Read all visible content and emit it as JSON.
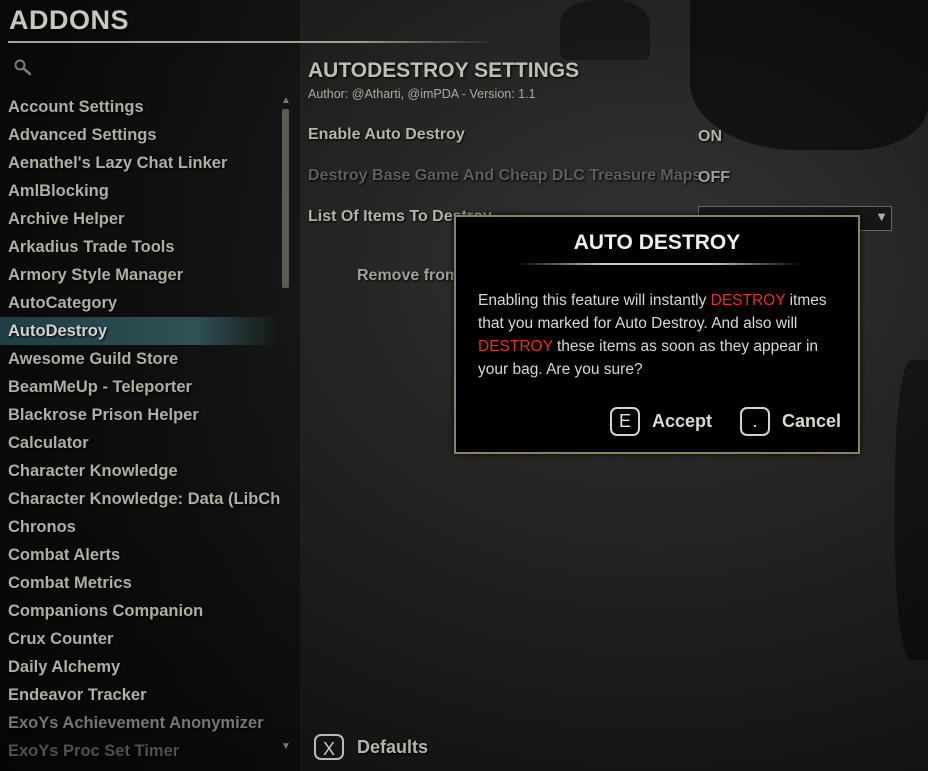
{
  "app": {
    "title": "ADDONS"
  },
  "addons": [
    {
      "label": "Account Settings",
      "state": "normal"
    },
    {
      "label": "Advanced Settings",
      "state": "normal"
    },
    {
      "label": "Aenathel's Lazy Chat Linker",
      "state": "normal"
    },
    {
      "label": "AmlBlocking",
      "state": "normal"
    },
    {
      "label": "Archive Helper",
      "state": "normal"
    },
    {
      "label": "Arkadius Trade Tools",
      "state": "normal"
    },
    {
      "label": "Armory Style Manager",
      "state": "normal"
    },
    {
      "label": "AutoCategory",
      "state": "normal"
    },
    {
      "label": "AutoDestroy",
      "state": "selected"
    },
    {
      "label": "Awesome Guild Store",
      "state": "normal"
    },
    {
      "label": "BeamMeUp - Teleporter",
      "state": "normal"
    },
    {
      "label": "Blackrose Prison Helper",
      "state": "normal"
    },
    {
      "label": "Calculator",
      "state": "normal"
    },
    {
      "label": "Character Knowledge",
      "state": "normal"
    },
    {
      "label": "Character Knowledge: Data (LibCh...",
      "state": "normal"
    },
    {
      "label": "Chronos",
      "state": "normal"
    },
    {
      "label": "Combat Alerts",
      "state": "normal"
    },
    {
      "label": "Combat Metrics",
      "state": "normal"
    },
    {
      "label": "Companions Companion",
      "state": "normal"
    },
    {
      "label": "Crux Counter",
      "state": "normal"
    },
    {
      "label": "Daily Alchemy",
      "state": "normal"
    },
    {
      "label": "Endeavor Tracker",
      "state": "normal"
    },
    {
      "label": "ExoYs Achievement Anonymizer",
      "state": "dim"
    },
    {
      "label": "ExoYs Proc Set Timer",
      "state": "dimmer"
    }
  ],
  "settings": {
    "title": "AUTODESTROY SETTINGS",
    "author": "Author: @Atharti, @imPDA - Version: 1.1",
    "enable_label": "Enable Auto Destroy",
    "enable_value": "ON",
    "maps_label": "Destroy Base Game And Cheap DLC Treasure Maps",
    "maps_value": "OFF",
    "list_label": "List Of Items To Destroy",
    "remove_button": "Remove from AutoDestroy"
  },
  "footer": {
    "defaults_key": "X",
    "defaults_label": "Defaults"
  },
  "dialog": {
    "title": "AUTO DESTROY",
    "body_1": "Enabling this feature will instantly ",
    "body_danger_1": "DESTROY",
    "body_2": " itmes that you marked for Auto Destroy. And also will ",
    "body_danger_2": "DESTROY",
    "body_3": " these items as soon as they appear in your bag. Are you sure?",
    "accept_key": "E",
    "accept_label": "Accept",
    "cancel_key": ".",
    "cancel_label": "Cancel"
  },
  "colors": {
    "danger": "#e23127",
    "selection": "#41707a",
    "dialog_border": "#8a8262"
  },
  "scroll": {
    "thumb_fraction": 0.27
  }
}
